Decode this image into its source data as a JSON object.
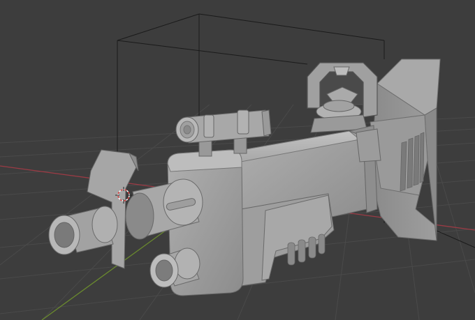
{
  "viewport": {
    "background": "#3d3d3d",
    "grid_color": "#4a4a4a",
    "x_axis_color": "#9b3b45",
    "y_axis_color": "#6a8a2e"
  },
  "model": {
    "base_color": "#9a9a9a",
    "light_color": "#b8b8b8",
    "dark_color": "#6e6e6e",
    "shadow_color": "#555555"
  },
  "camera_frame": {
    "color": "#1a1a1a"
  },
  "cursor": {
    "icon": "3d-cursor-icon",
    "ring_color": "#d94040"
  }
}
